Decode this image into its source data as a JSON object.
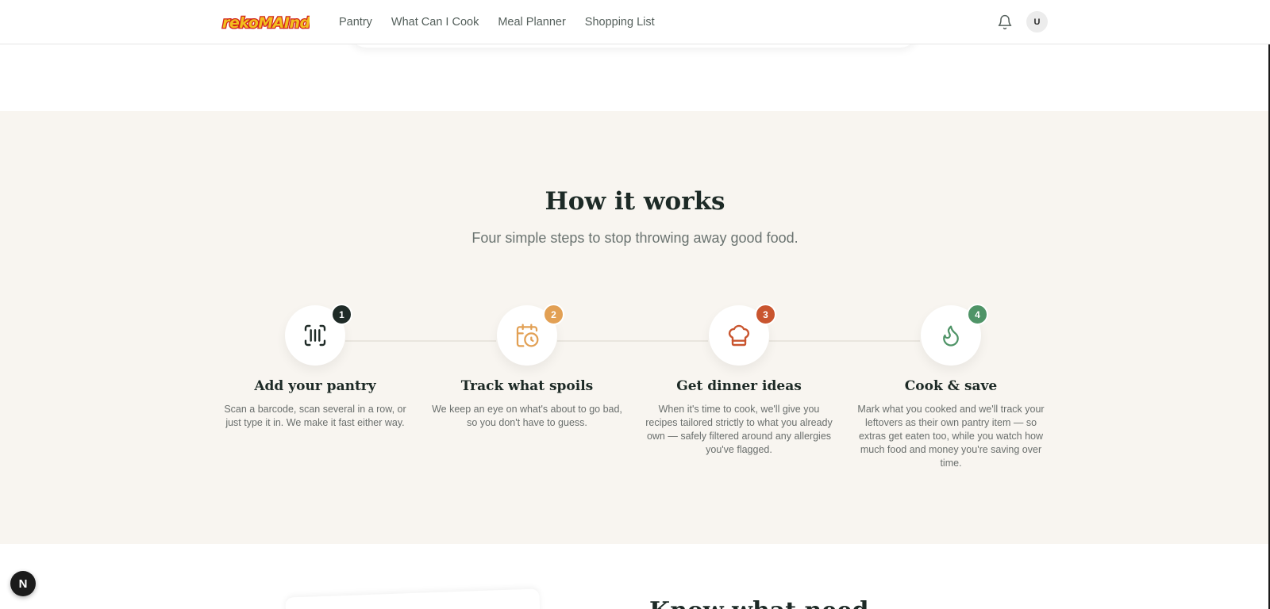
{
  "nav": {
    "logo_text": "rekoMAInda",
    "links": [
      "Pantry",
      "What Can I Cook",
      "Meal Planner",
      "Shopping List"
    ],
    "avatar_initial": "U"
  },
  "how_it_works": {
    "title": "How it works",
    "subtitle": "Four simple steps to stop throwing away good food.",
    "steps": [
      {
        "number": "1",
        "title": "Add your pantry",
        "description": "Scan a barcode, scan several in a row, or just type it in. We make it fast either way.",
        "icon": "barcode-scan-icon",
        "color": "#1f2b27"
      },
      {
        "number": "2",
        "title": "Track what spoils",
        "description": "We keep an eye on what's about to go bad, so you don't have to guess.",
        "icon": "calendar-clock-icon",
        "color": "#e2a054"
      },
      {
        "number": "3",
        "title": "Get dinner ideas",
        "description": "When it's time to cook, we'll give you recipes tailored strictly to what you already own — safely filtered around any allergies you've flagged.",
        "icon": "chef-hat-icon",
        "color": "#c9552f"
      },
      {
        "number": "4",
        "title": "Cook & save",
        "description": "Mark what you cooked and we'll track your leftovers as their own pantry item — so extras get eaten too, while you watch how much food and money you're saving over time.",
        "icon": "flame-icon",
        "color": "#4f9467"
      }
    ]
  },
  "next_section": {
    "heading_partial": "Know what need"
  },
  "dev_badge": "N"
}
